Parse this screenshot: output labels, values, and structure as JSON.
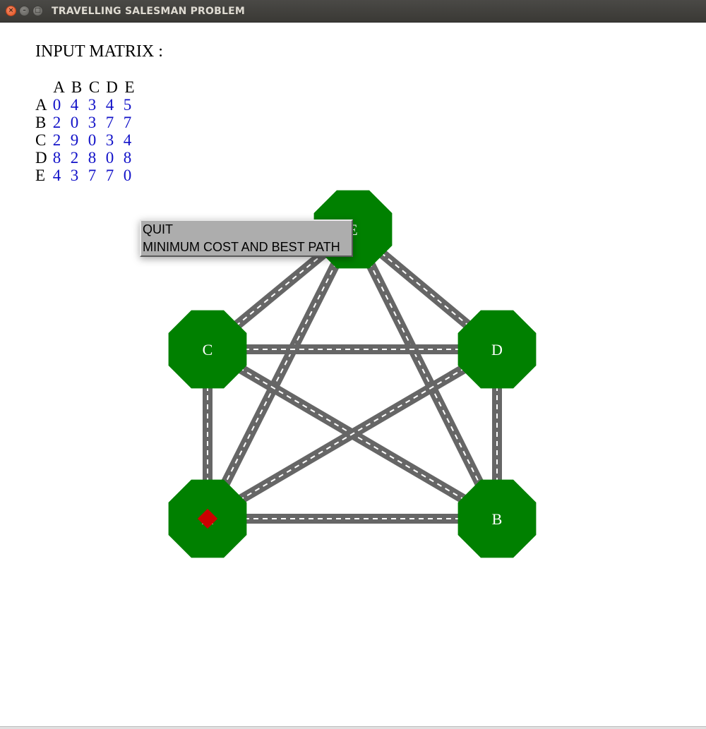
{
  "window": {
    "title": "TRAVELLING SALESMAN PROBLEM",
    "controls": {
      "close": "×",
      "minimize": "–",
      "maximize": "□"
    }
  },
  "heading": "INPUT MATRIX :",
  "matrix": {
    "columns": [
      "A",
      "B",
      "C",
      "D",
      "E"
    ],
    "rows": [
      {
        "label": "A",
        "values": [
          "0",
          "4",
          "3",
          "4",
          "5"
        ]
      },
      {
        "label": "B",
        "values": [
          "2",
          "0",
          "3",
          "7",
          "7"
        ]
      },
      {
        "label": "C",
        "values": [
          "2",
          "9",
          "0",
          "3",
          "4"
        ]
      },
      {
        "label": "D",
        "values": [
          "8",
          "2",
          "8",
          "0",
          "8"
        ]
      },
      {
        "label": "E",
        "values": [
          "4",
          "3",
          "7",
          "7",
          "0"
        ]
      }
    ]
  },
  "graph": {
    "nodes": [
      {
        "id": "E",
        "label": "E"
      },
      {
        "id": "C",
        "label": "C"
      },
      {
        "id": "D",
        "label": "D"
      },
      {
        "id": "A",
        "label": "A"
      },
      {
        "id": "B",
        "label": "B"
      }
    ],
    "node_color": "#008000",
    "road_color": "#666666",
    "lane_color": "#ffffff",
    "marker_color": "#cc0000",
    "marker_at": "A"
  },
  "menu": {
    "items": [
      {
        "label": "QUIT"
      },
      {
        "label": "MINIMUM COST AND BEST PATH"
      }
    ]
  }
}
